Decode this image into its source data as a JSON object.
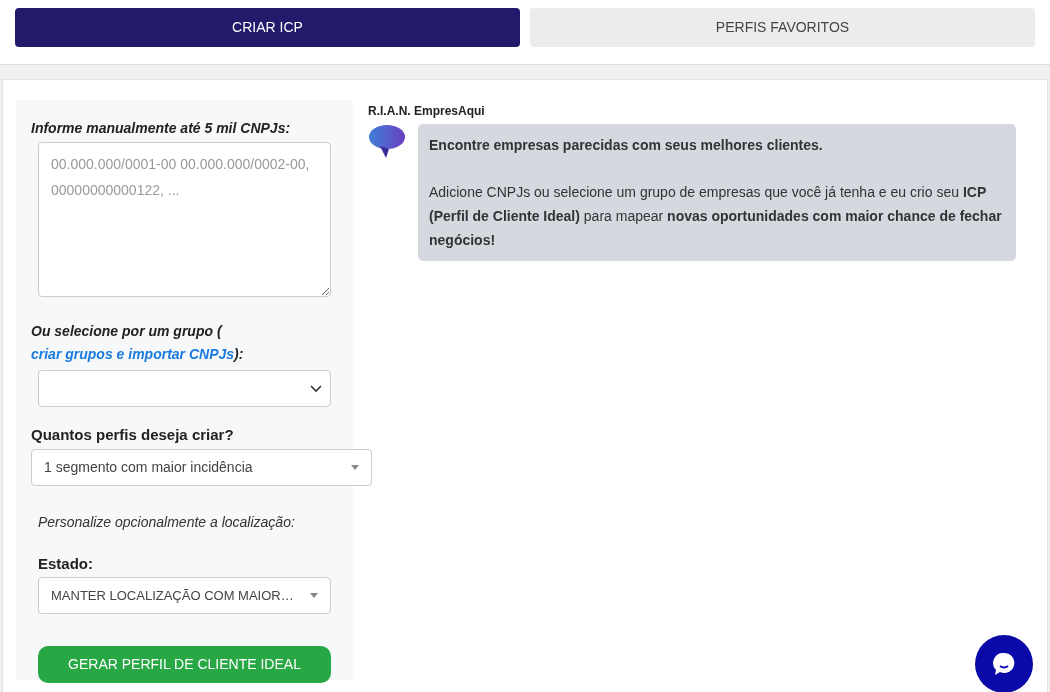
{
  "tabs": [
    {
      "label": "CRIAR ICP",
      "selected": true
    },
    {
      "label": "PERFIS FAVORITOS",
      "selected": false
    }
  ],
  "form": {
    "cnpj_label": "Informe manualmente até 5 mil CNPJs:",
    "cnpj_placeholder": "00.000.000/0001-00 00.000.000/0002-00, 00000000000122, ...",
    "group_label_before": "Ou selecione por um grupo (",
    "group_link": "criar grupos e importar CNPJs",
    "group_label_after": "):",
    "profiles_label": "Quantos perfis deseja criar?",
    "profiles_value": "1 segmento com maior incidência",
    "location_note": "Personalize opcionalmente a localização:",
    "state_label": "Estado:",
    "state_value": "MANTER LOCALIZAÇÃO COM MAIOR…",
    "submit": "GERAR PERFIL DE CLIENTE IDEAL"
  },
  "chat": {
    "sender": "R.I.A.N. EmpresAqui",
    "headline": "Encontre empresas parecidas com seus melhores clientes.",
    "body": "Adicione CNPJs ou selecione um grupo de empresas que você já tenha e eu crio seu **ICP (Perfil de Cliente Ideal)** para mapear **novas oportunidades com maior chance de fechar negócios!**"
  }
}
